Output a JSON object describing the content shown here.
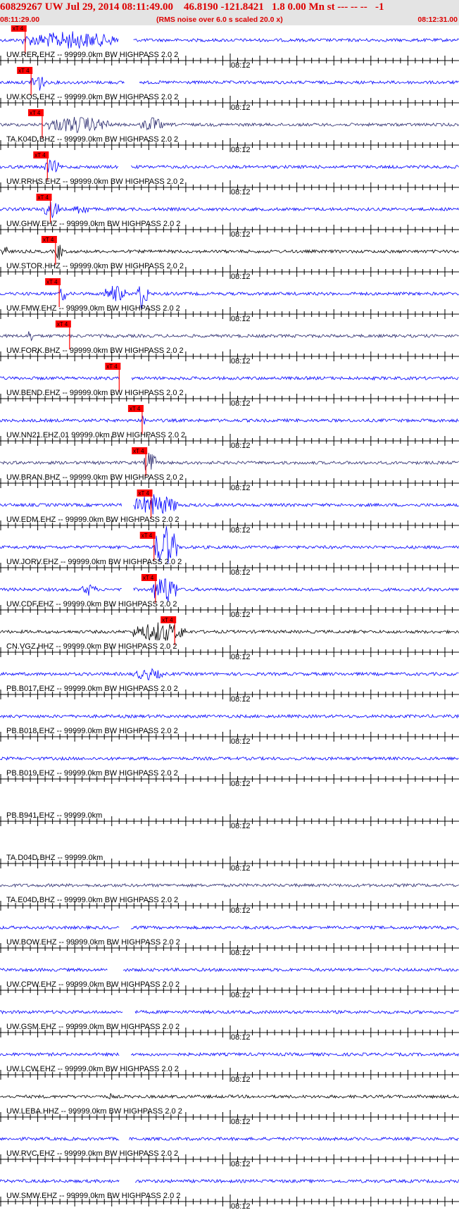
{
  "header": {
    "title": "60829267 UW Jul 29, 2014 08:11:49.00    46.8190 -121.8421   1.8 0.00 Mn st --- -- --   -1",
    "start_time": "08:11:29.00",
    "note": "(RMS noise over 6.0 s scaled 20.0 x)",
    "end_time": "08:12:31.00",
    "title_color": "#dd0000",
    "background": "#e4e4e4"
  },
  "chart_data": {
    "type": "line",
    "x_unit": "seconds after 08:11:29.00",
    "xlim": [
      0,
      62
    ],
    "time_marker_label": "08:12",
    "time_marker_seconds": 31,
    "tick_interval_seconds": 1,
    "pick_label": "xT 4",
    "pick_color": "#ff0000",
    "traces": [
      {
        "label": "UW.RER.EHZ -- 99999.0km BW  HIGHPASS  2.0  2",
        "color": "#0000ff",
        "pick": 3.4,
        "events": [
          {
            "t": [
              3,
              16
            ],
            "a": 2.2
          }
        ],
        "gaps": [
          [
            16.0,
            18.0
          ]
        ]
      },
      {
        "label": "UW.KOS.EHZ -- 99999.0km BW  HIGHPASS  2.0  2",
        "color": "#0000ff",
        "pick": 4.2,
        "events": [
          {
            "t": [
              4,
              6
            ],
            "a": 2.8
          }
        ],
        "gaps": [
          [
            16.8,
            18.8
          ]
        ]
      },
      {
        "label": "TA.K04D.BHZ -- 99999.0km BW  HIGHPASS  2.0  2",
        "color": "#2a2a6e",
        "pick": 5.7,
        "events": [
          {
            "t": [
              6,
              15
            ],
            "a": 2.0
          },
          {
            "t": [
              19,
              22
            ],
            "a": 1.8
          }
        ],
        "gaps": []
      },
      {
        "label": "UW.RRHS.EHZ -- 99999.0km BW  HIGHPASS  2.0  2",
        "color": "#0000ff",
        "pick": 6.4,
        "events": [
          {
            "t": [
              6,
              8
            ],
            "a": 1.8
          }
        ],
        "gaps": [
          [
            16.0,
            17.6
          ]
        ]
      },
      {
        "label": "UW.GHW.EHZ -- 99999.0km BW  HIGHPASS  2.0  2",
        "color": "#0000ff",
        "pick": 6.8,
        "events": [
          {
            "t": [
              6,
              8
            ],
            "a": 2.4
          },
          {
            "t": [
              10,
              12
            ],
            "a": 1.3
          }
        ],
        "gaps": []
      },
      {
        "label": "UW.STOR.HHZ -- 99999.0km BW  HIGHPASS  2.0  2",
        "color": "#000000",
        "pick": 7.5,
        "events": [
          {
            "t": [
              0,
              1
            ],
            "a": 1.8
          },
          {
            "t": [
              7.5,
              8.5
            ],
            "a": 2.2
          }
        ],
        "gaps": []
      },
      {
        "label": "UW.FMW.EHZ -- 99999.0km BW  HIGHPASS  2.0  2",
        "color": "#0000ff",
        "pick": 8.0,
        "events": [
          {
            "t": [
              8,
              9
            ],
            "a": 1.8
          },
          {
            "t": [
              14,
              17
            ],
            "a": 2.2
          },
          {
            "t": [
              18.5,
              20
            ],
            "a": 4.5
          }
        ],
        "gaps": []
      },
      {
        "label": "UW.FORK.BHZ -- 99999.0km BW  HIGHPASS  2.0  2",
        "color": "#2a2a6e",
        "pick": 9.4,
        "events": [
          {
            "t": [
              3.8,
              4.4
            ],
            "a": 2.2
          }
        ],
        "gaps": []
      },
      {
        "label": "UW.BEND.EHZ -- 99999.0km BW  HIGHPASS  2.0  2",
        "color": "#0000ff",
        "pick": 16.1,
        "events": [],
        "gaps": [
          [
            16.2,
            17.8
          ]
        ]
      },
      {
        "label": "UW.NN21.EHZ.01 99999.0km BW  HIGHPASS  2.0  2",
        "color": "#0000ff",
        "pick": 19.2,
        "events": [
          {
            "t": [
              19.2,
              19.8
            ],
            "a": 2.2
          }
        ],
        "gaps": []
      },
      {
        "label": "UW.BRAN.BHZ -- 99999.0km BW  HIGHPASS  2.0  2",
        "color": "#2a2a6e",
        "pick": 19.7,
        "events": [
          {
            "t": [
              19.5,
              21
            ],
            "a": 3.5
          }
        ],
        "gaps": []
      },
      {
        "label": "UW.EDM.EHZ -- 99999.0km BW  HIGHPASS  2.0  2",
        "color": "#0000ff",
        "pick": 20.4,
        "events": [
          {
            "t": [
              18,
              24
            ],
            "a": 2.8
          }
        ],
        "gaps": [
          [
            16.5,
            18.0
          ]
        ]
      },
      {
        "label": "UW.JORV.EHZ -- 99999.0km BW  HIGHPASS  2.0  2",
        "color": "#0000ff",
        "pick": 20.8,
        "events": [
          {
            "t": [
              20.8,
              24
            ],
            "a": 6.0
          }
        ],
        "gaps": []
      },
      {
        "label": "UW.CDF.EHZ -- 99999.0km BW  HIGHPASS  2.0  2",
        "color": "#0000ff",
        "pick": 21.0,
        "events": [
          {
            "t": [
              11,
              13
            ],
            "a": 1.4
          },
          {
            "t": [
              20.5,
              24
            ],
            "a": 4.0
          }
        ],
        "gaps": [
          [
            16.5,
            18.0
          ]
        ]
      },
      {
        "label": "CN.VGZ.HHZ -- 99999.0km BW  HIGHPASS  2.0  2",
        "color": "#000000",
        "pick": 23.6,
        "events": [
          {
            "t": [
              18,
              25
            ],
            "a": 2.6
          }
        ],
        "gaps": []
      },
      {
        "label": "PB.B017.EHZ -- 99999.0km BW  HIGHPASS  2.0  2",
        "color": "#0000ff",
        "pick": null,
        "events": [
          {
            "t": [
              18,
              22
            ],
            "a": 1.3
          }
        ],
        "gaps": []
      },
      {
        "label": "PB.B018.EHZ -- 99999.0km BW  HIGHPASS  2.0  2",
        "color": "#0000ff",
        "pick": null,
        "events": [],
        "gaps": []
      },
      {
        "label": "PB.B019.EHZ -- 99999.0km BW  HIGHPASS  2.0  2",
        "color": "#0000ff",
        "pick": null,
        "events": [],
        "gaps": []
      },
      {
        "label": "PB.B941.EHZ -- 99999.0km",
        "color": "#0000ff",
        "pick": null,
        "events": [],
        "gaps": [
          [
            0,
            62
          ]
        ]
      },
      {
        "label": "TA.D04D.BHZ -- 99999.0km",
        "color": "#2a2a6e",
        "pick": null,
        "events": [],
        "gaps": [
          [
            0,
            62
          ]
        ]
      },
      {
        "label": "TA.E04D.BHZ -- 99999.0km BW  HIGHPASS  2.0  2",
        "color": "#2a2a6e",
        "pick": null,
        "events": [],
        "gaps": []
      },
      {
        "label": "UW.BOW.EHZ -- 99999.0km BW  HIGHPASS  2.0  2",
        "color": "#0000ff",
        "pick": null,
        "events": [],
        "gaps": [
          [
            16.2,
            17.6
          ]
        ]
      },
      {
        "label": "UW.CPW.EHZ -- 99999.0km BW  HIGHPASS  2.0  2",
        "color": "#0000ff",
        "pick": null,
        "events": [],
        "gaps": [
          [
            14.6,
            16.6
          ]
        ]
      },
      {
        "label": "UW.GSM.EHZ -- 99999.0km BW  HIGHPASS  2.0  2",
        "color": "#0000ff",
        "pick": null,
        "events": [],
        "gaps": [
          [
            16.6,
            18.2
          ]
        ]
      },
      {
        "label": "UW.LCW.EHZ -- 99999.0km BW  HIGHPASS  2.0  2",
        "color": "#0000ff",
        "pick": null,
        "events": [],
        "gaps": [
          [
            16.2,
            17.6
          ]
        ]
      },
      {
        "label": "UW.LEBA.HHZ -- 99999.0km BW  HIGHPASS  2.0  2",
        "color": "#000000",
        "pick": null,
        "events": [
          {
            "t": [
              14.8,
              15.0
            ],
            "a": 1.6
          }
        ],
        "gaps": []
      },
      {
        "label": "UW.RVC.EHZ -- 99999.0km BW  HIGHPASS  2.0  2",
        "color": "#0000ff",
        "pick": null,
        "events": [],
        "gaps": [
          [
            16.2,
            17.4
          ]
        ]
      },
      {
        "label": "UW.SMW.EHZ -- 99999.0km BW  HIGHPASS  2.0  2",
        "color": "#0000ff",
        "pick": null,
        "events": [],
        "gaps": [
          [
            16.2,
            18.2
          ]
        ]
      }
    ]
  }
}
